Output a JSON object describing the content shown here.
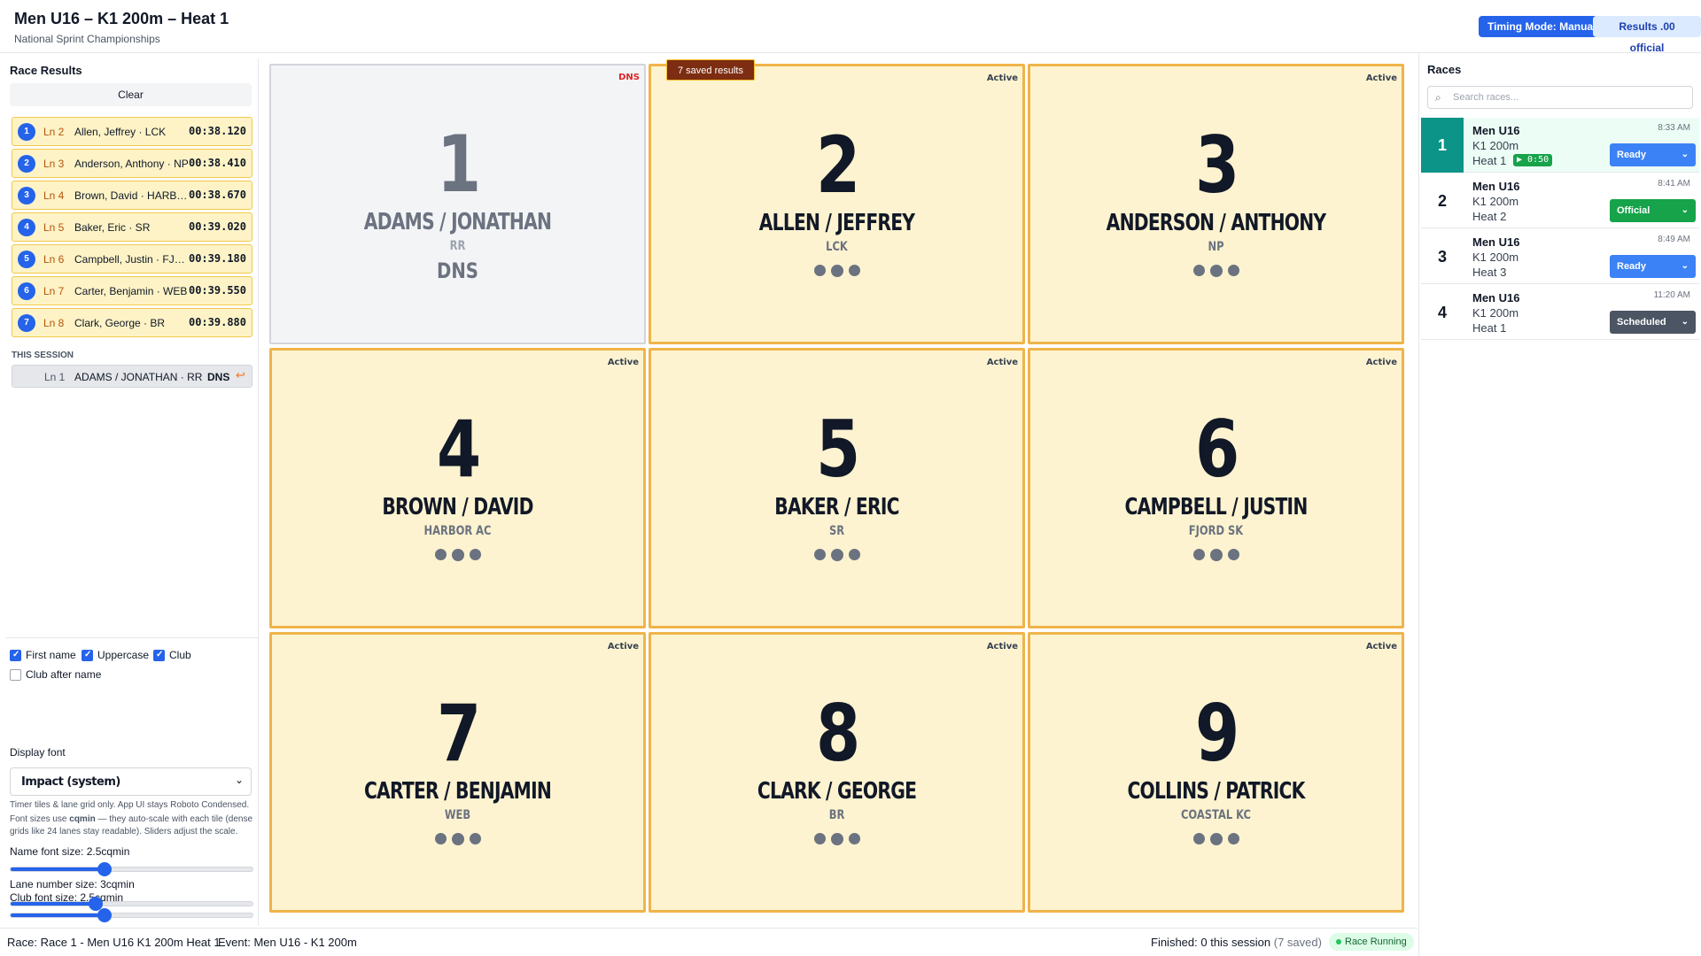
{
  "header": {
    "title": "Men U16 – K1 200m – Heat 1",
    "subtitle": "National Sprint Championships",
    "timing_mode_label": "Timing Mode: Manual",
    "results_official_label": "Results .00 official"
  },
  "left": {
    "title": "Race Results",
    "clear_label": "Clear",
    "results": [
      {
        "pos": "1",
        "lane": "Ln 2",
        "name": "Allen, Jeffrey · LCK",
        "time": "00:38.120"
      },
      {
        "pos": "2",
        "lane": "Ln 3",
        "name": "Anderson, Anthony · NP",
        "time": "00:38.410"
      },
      {
        "pos": "3",
        "lane": "Ln 4",
        "name": "Brown, David · HARBOR AC",
        "time": "00:38.670"
      },
      {
        "pos": "4",
        "lane": "Ln 5",
        "name": "Baker, Eric · SR",
        "time": "00:39.020"
      },
      {
        "pos": "5",
        "lane": "Ln 6",
        "name": "Campbell, Justin · FJORD SK",
        "time": "00:39.180"
      },
      {
        "pos": "6",
        "lane": "Ln 7",
        "name": "Carter, Benjamin · WEB",
        "time": "00:39.550"
      },
      {
        "pos": "7",
        "lane": "Ln 8",
        "name": "Clark, George · BR",
        "time": "00:39.880"
      }
    ],
    "session_label": "THIS SESSION",
    "session": {
      "lane": "Ln 1",
      "name": "ADAMS / JONATHAN · RR",
      "status": "DNS",
      "undo_icon": "↩"
    },
    "settings": {
      "first_name": "First name",
      "uppercase": "Uppercase",
      "club": "Club",
      "club_after_name": "Club after name",
      "display_font_label": "Display font",
      "display_font_value": "Impact (system)",
      "hint1": "Timer tiles & lane grid only. App UI stays Roboto Condensed.",
      "hint2_a": "Font sizes use ",
      "hint2_b": "cqmin",
      "hint2_c": " — they auto-scale with each tile (dense grids like 24 lanes stay readable). Sliders adjust the scale.",
      "name_size_label": "Name font size: ",
      "name_size_value": "2.5cqmin",
      "club_size_label": "Club font size: ",
      "club_size_value": "2.5cqmin",
      "lane_size_label": "Lane number size: ",
      "lane_size_value": "3cqmin",
      "name_slider_fraction": 0.39,
      "club_slider_fraction": 0.39,
      "lane_slider_fraction": 0.35
    }
  },
  "grid": {
    "saved_tag": "7 saved results",
    "tiles": [
      {
        "lane": "1",
        "athlete": "ADAMS / JONATHAN",
        "club": "RR",
        "badge": "DNS",
        "dns": true,
        "dns_text": "DNS"
      },
      {
        "lane": "2",
        "athlete": "ALLEN / JEFFREY",
        "club": "LCK",
        "badge": "Active"
      },
      {
        "lane": "3",
        "athlete": "ANDERSON / ANTHONY",
        "club": "NP",
        "badge": "Active"
      },
      {
        "lane": "4",
        "athlete": "BROWN / DAVID",
        "club": "HARBOR AC",
        "badge": "Active"
      },
      {
        "lane": "5",
        "athlete": "BAKER / ERIC",
        "club": "SR",
        "badge": "Active"
      },
      {
        "lane": "6",
        "athlete": "CAMPBELL / JUSTIN",
        "club": "FJORD SK",
        "badge": "Active"
      },
      {
        "lane": "7",
        "athlete": "CARTER / BENJAMIN",
        "club": "WEB",
        "badge": "Active"
      },
      {
        "lane": "8",
        "athlete": "CLARK / GEORGE",
        "club": "BR",
        "badge": "Active"
      },
      {
        "lane": "9",
        "athlete": "COLLINS / PATRICK",
        "club": "COASTAL KC",
        "badge": "Active"
      }
    ]
  },
  "right": {
    "title": "Races",
    "search_placeholder": "Search races...",
    "search_icon": "search-icon",
    "races": [
      {
        "num": "1",
        "l1": "Men U16",
        "l2": "K1 200m",
        "l3": "Heat 1",
        "time": "8:33 AM",
        "status": "Ready",
        "timer": "▶ 0:50",
        "active": true
      },
      {
        "num": "2",
        "l1": "Men U16",
        "l2": "K1 200m",
        "l3": "Heat 2",
        "time": "8:41 AM",
        "status": "Official"
      },
      {
        "num": "3",
        "l1": "Men U16",
        "l2": "K1 200m",
        "l3": "Heat 3",
        "time": "8:49 AM",
        "status": "Ready"
      },
      {
        "num": "4",
        "l1": "Men U16",
        "l2": "K1 200m",
        "l3": "Heat 1",
        "time": "11:20 AM",
        "status": "Scheduled"
      }
    ]
  },
  "footer": {
    "race_info": "Race: Race 1 - Men U16 K1 200m Heat 1",
    "event_info": "Event: Men U16 - K1 200m",
    "finished": "Finished: 0 this session",
    "finished_saved": " (7 saved)",
    "running": "Race Running"
  },
  "colors": {
    "accent": "#2563eb",
    "tile_bg": "#fdf3d0",
    "tile_border": "#f0b44a",
    "active_race": "#0d9488",
    "official": "#16a34a",
    "scheduled": "#4b5563"
  }
}
